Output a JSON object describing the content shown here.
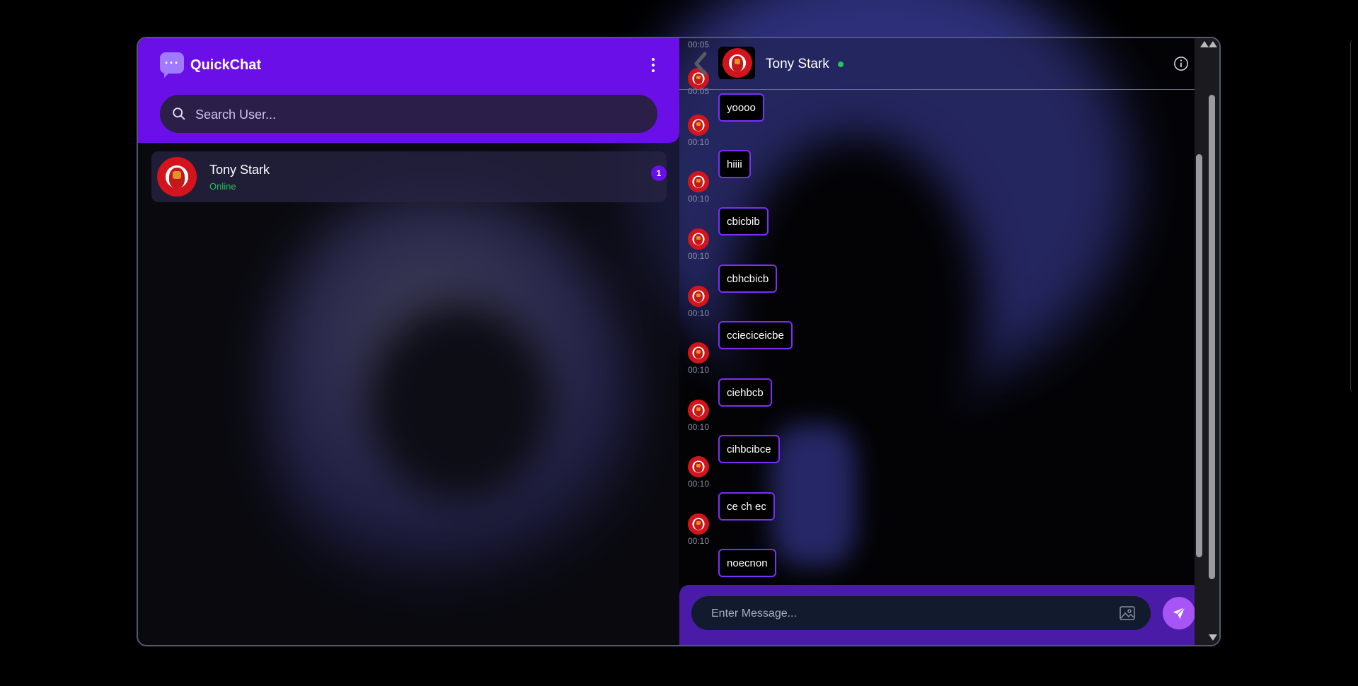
{
  "app": {
    "title": "QuickChat"
  },
  "sidebar": {
    "search_placeholder": "Search User...",
    "contacts": [
      {
        "name": "Tony Stark",
        "status": "Online",
        "unread": "1"
      }
    ]
  },
  "chat": {
    "contact_name": "Tony Stark",
    "top_time": "00:05",
    "messages": [
      {
        "text": "",
        "time": "00:05"
      },
      {
        "text": "yoooo",
        "time": "00:10"
      },
      {
        "text": "hiiii",
        "time": "00:10"
      },
      {
        "text": "cbicbib",
        "time": "00:10"
      },
      {
        "text": "cbhcbicb",
        "time": "00:10"
      },
      {
        "text": "ccieciceicbe",
        "time": "00:10"
      },
      {
        "text": "ciehbcb",
        "time": "00:10"
      },
      {
        "text": "cihbcibce",
        "time": "00:10"
      },
      {
        "text": "ce ch ec",
        "time": "00:10"
      },
      {
        "text": "noecnon",
        "time": ""
      }
    ],
    "message_placeholder": "Enter Message..."
  },
  "colors": {
    "accent": "#6a0fe8",
    "bubble_border": "#7b2dff",
    "online": "#22c55e",
    "send_button": "#a855f7",
    "composer": "#4a1ba6"
  },
  "icons": {
    "logo": "chat-bubble-icon",
    "menu": "kebab-menu-icon",
    "search": "search-icon",
    "back": "back-arrow-icon",
    "info": "info-icon",
    "attach": "image-icon",
    "send": "send-icon"
  }
}
